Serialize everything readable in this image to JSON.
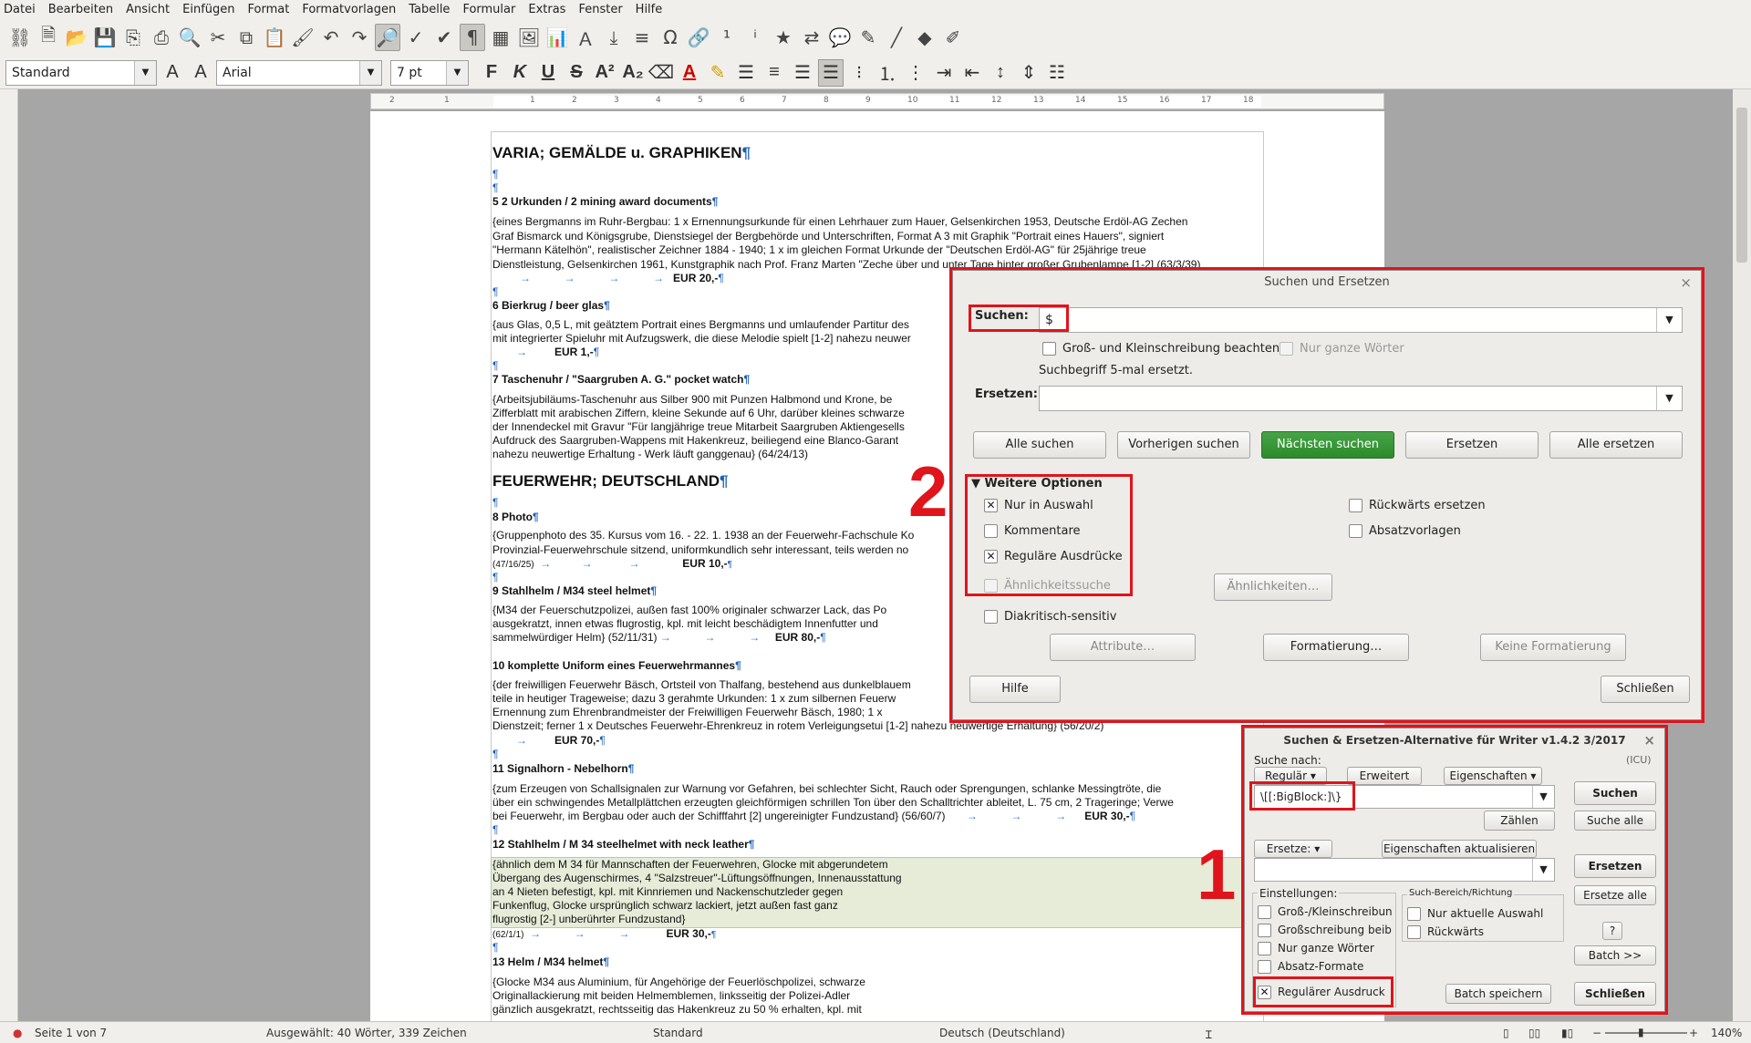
{
  "menu": [
    "Datei",
    "Bearbeiten",
    "Ansicht",
    "Einfügen",
    "Format",
    "Formatvorlagen",
    "Tabelle",
    "Formular",
    "Extras",
    "Fenster",
    "Hilfe"
  ],
  "toolbar2": {
    "style": "Standard",
    "font": "Arial",
    "size": "7 pt",
    "bold": "F",
    "italic": "K",
    "underline": "U",
    "strike": "S",
    "sup": "A²",
    "sub": "A₂",
    "textcolor": "A"
  },
  "ruler": {
    "ticks": [
      "2",
      "1",
      "1",
      "2",
      "3",
      "4",
      "5",
      "6",
      "7",
      "8",
      "9",
      "10",
      "11",
      "12",
      "13",
      "14",
      "15",
      "16",
      "17",
      "18"
    ]
  },
  "doc": {
    "h_varia": "VARIA; GEMÄLDE u. GRAPHIKEN",
    "e5": "5 2 Urkunden / 2 mining award documents",
    "e5a": "{eines Bergmanns im Ruhr-Bergbau: 1 x Ernennungsurkunde für einen Lehrhauer zum Hauer, Gelsenkirchen 1953, Deutsche Erdöl-AG Zechen",
    "e5b": "Graf Bismarck und Königsgrube, Dienstsiegel der Bergbehörde und Unterschriften, Format A 3 mit Graphik \"Portrait eines Hauers\", signiert",
    "e5c": "\"Hermann Kätelhön\", realistischer Zeichner 1884 - 1940; 1 x im gleichen Format Urkunde der \"Deutschen Erdöl-AG\" für 25jährige treue",
    "e5d": "Dienstleistung, Gelsenkirchen 1961, Kunstgraphik nach Prof. Franz Marten \"Zeche über und unter Tage hinter großer Grubenlampe [1-2] (63/3/39)",
    "e5price": "EUR 20,-",
    "e6": "6 Bierkrug / beer glas",
    "e6a": "{aus Glas, 0,5 L, mit geätztem Portrait eines Bergmanns und umlaufender Partitur des",
    "e6b": "mit integrierter Spieluhr mit Aufzugswerk, die diese Melodie spielt [1-2] nahezu neuwer",
    "e6price": "EUR 1,-",
    "e7": "7 Taschenuhr / \"Saargruben A. G.\" pocket watch",
    "e7a": "{Arbeitsjubiläums-Taschenuhr aus Silber 900 mit Punzen Halbmond und Krone, be",
    "e7b": "Zifferblatt mit arabischen Ziffern, kleine Sekunde auf 6 Uhr, darüber kleines schwarze",
    "e7c": "der Innendeckel mit Gravur \"Für langjährige treue Mitarbeit Saargruben Aktiengesells",
    "e7d": "Aufdruck des Saargruben-Wappens mit Hakenkreuz, beiliegend eine Blanco-Garant",
    "e7e": "nahezu neuwertige Erhaltung - Werk läuft ganggenau} (64/24/13)",
    "h_feuer": "FEUERWEHR; DEUTSCHLAND",
    "e8": "8 Photo",
    "e8a": "{Gruppenphoto des 35. Kursus vom 16. - 22. 1. 1938 an der Feuerwehr-Fachschule Ko",
    "e8b": "Provinzial-Feuerwehrschule sitzend, uniformkundlich sehr interessant, teils werden no",
    "e8c": "(47/16/25)",
    "e8price": "EUR 10,-",
    "e9": "9 Stahlhelm / M34 steel helmet",
    "e9a": "{M34 der Feuerschutzpolizei, außen fast 100% originaler schwarzer Lack, das Po",
    "e9b": "ausgekratzt, innen etwas flugrostig, kpl. mit leicht beschädigtem Innenfutter und",
    "e9c": "sammelwürdiger Helm} (52/11/31)",
    "e9price": "EUR 80,-",
    "e10": "10 komplette Uniform eines Feuerwehrmannes",
    "e10a": "{der freiwilligen Feuerwehr Bäsch, Ortsteil von Thalfang, bestehend aus dunkelblauem",
    "e10b": "teile in heutiger Trageweise; dazu 3 gerahmte Urkunden: 1 x zum silbernen Feuerw",
    "e10c": "Ernennung zum Ehrenbrandmeister der Freiwilligen Feuerwehr Bäsch, 1980; 1 x",
    "e10d": "Dienstzeit; ferner 1 x Deutsches Feuerwehr-Ehrenkreuz in rotem Verleigungsetui [1-2] nahezu neuwertige Erhaltung} (56/20/2)",
    "e10price": "EUR 70,-",
    "e11": "11 Signalhorn - Nebelhorn",
    "e11a": "{zum Erzeugen von Schallsignalen zur Warnung vor Gefahren, bei schlechter Sicht, Rauch oder Sprengungen, schlanke Messingtröte, die",
    "e11b": "über ein schwingendes Metallplättchen erzeugten gleichförmigen schrillen Ton über den Schalltrichter ableitet, L. 75 cm, 2 Trageringe; Verwe",
    "e11c": "bei Feuerwehr, im Bergbau oder auch der Schifffahrt [2] ungereinigter Fundzustand} (56/60/7)",
    "e11price": "EUR 30,-",
    "e12": "12 Stahlhelm / M 34 steelhelmet with neck leather",
    "e12a": "{ähnlich dem M 34 für Mannschaften der Feuerwehren, Glocke mit abgerundetem",
    "e12b": "Übergang des Augenschirmes, 4 \"Salzstreuer\"-Lüftungsöffnungen, Innenausstattung",
    "e12c": "an 4 Nieten befestigt, kpl. mit Kinnriemen und Nackenschutzleder gegen",
    "e12d": "Funkenflug, Glocke ursprünglich schwarz lackiert, jetzt außen fast ganz",
    "e12e": "flugrostig [2-] unberührter Fundzustand}",
    "e12f": "(62/1/1)",
    "e12price": "EUR 30,-",
    "e13": "13 Helm / M34 helmet",
    "e13a": "{Glocke M34 aus Aluminium, für Angehörige der Feuerlöschpolizei, schwarze",
    "e13b": "Originallackierung mit beiden Helmemblemen, linksseitig der Polizei-Adler",
    "e13c": "gänzlich ausgekratzt, rechtsseitig das Hakenkreuz zu 50 % erhalten, kpl. mit"
  },
  "dialog1": {
    "title": "Suchen und Ersetzen",
    "search_label": "Suchen:",
    "search_value": "$",
    "match_case": "Groß- und Kleinschreibung beachten",
    "whole_words": "Nur ganze Wörter",
    "status": "Suchbegriff 5-mal ersetzt.",
    "replace_label": "Ersetzen:",
    "btn_find_all": "Alle suchen",
    "btn_find_prev": "Vorherigen suchen",
    "btn_find_next": "Nächsten suchen",
    "btn_replace": "Ersetzen",
    "btn_replace_all": "Alle ersetzen",
    "more_options": "Weitere Optionen",
    "only_selection": "Nur in Auswahl",
    "comments": "Kommentare",
    "regex": "Reguläre Ausdrücke",
    "similarity": "Ähnlichkeitssuche",
    "btn_similarity": "Ähnlichkeiten…",
    "diacritics": "Diakritisch-sensitiv",
    "backwards": "Rückwärts ersetzen",
    "para_styles": "Absatzvorlagen",
    "btn_attributes": "Attribute…",
    "btn_format": "Formatierung…",
    "btn_no_format": "Keine Formatierung",
    "btn_help": "Hilfe",
    "btn_close": "Schließen"
  },
  "dialog2": {
    "title": "Suchen & Ersetzen-Alternative für Writer v1.4.2  3/2017",
    "icu": "(ICU)",
    "search_for": "Suche nach:",
    "tab_regular": "Regulär",
    "tab_extended": "Erweitert",
    "tab_properties": "Eigenschaften",
    "search_value": "\\[[:BigBlock:]\\}",
    "btn_search": "Suchen",
    "btn_count": "Zählen",
    "btn_search_all": "Suche alle",
    "replace_label": "Ersetze:",
    "update_props": "Eigenschaften aktualisieren",
    "btn_replace": "Ersetzen",
    "btn_replace_all": "Ersetze alle",
    "settings": "Einstellungen:",
    "opt_case": "Groß-/Kleinschreibun",
    "opt_caps": "Großschreibung beib",
    "opt_whole": "Nur ganze Wörter",
    "opt_para": "Absatz-Formate",
    "opt_regex": "Regulärer Ausdruck",
    "area_title": "Such-Bereich/Richtung",
    "opt_selection": "Nur aktuelle Auswahl",
    "opt_backwards": "Rückwärts",
    "btn_help": "?",
    "btn_batch": "Batch >>",
    "btn_batch_save": "Batch speichern",
    "btn_close": "Schließen"
  },
  "annotations": {
    "one": "1",
    "two": "2"
  },
  "status": {
    "page": "Seite 1 von 7",
    "selection": "Ausgewählt: 40 Wörter, 339 Zeichen",
    "style": "Standard",
    "lang": "Deutsch (Deutschland)",
    "zoom": "140%"
  },
  "colors": {
    "accent_red": "#e0141b",
    "green_button": "#3a9a3a"
  }
}
